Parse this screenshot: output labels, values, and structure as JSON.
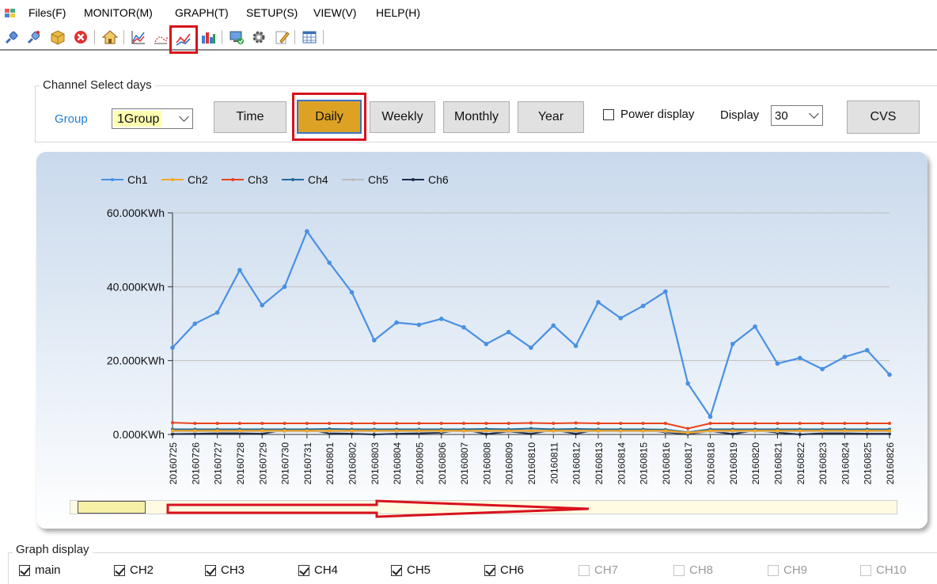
{
  "menu": [
    "Files(F)",
    "MONITOR(M)",
    "GRAPH(T)",
    "SETUP(S)",
    "VIEW(V)",
    "HELP(H)"
  ],
  "toolbar": {
    "icons": [
      "connect-icon",
      "disconnect-icon",
      "package-icon",
      "stop-icon",
      "home-icon",
      "area-chart-icon",
      "scatter-chart-icon",
      "line-chart-icon",
      "bar-chart-icon",
      "monitor-icon",
      "gear-icon",
      "edit-icon",
      "table-icon"
    ],
    "highlighted": "line-chart-icon"
  },
  "channel_select": {
    "title": "Channel Select days",
    "group_label": "Group",
    "group_value": "1Group",
    "buttons": [
      "Time",
      "Daily",
      "Weekly",
      "Monthly",
      "Year"
    ],
    "active_button": "Daily",
    "power_display_label": "Power display",
    "power_display_checked": false,
    "display_label": "Display",
    "display_value": "30",
    "cvs_label": "CVS"
  },
  "colors": {
    "ch1": "#4a90e2",
    "ch2": "#f5a623",
    "ch3": "#e8431c",
    "ch4": "#1f6a9a",
    "ch5": "#bdbdbd",
    "ch6": "#1c2b4a",
    "accent_active": "#dda224",
    "highlight_box": "#d8121c",
    "group_label": "#1e7fd6"
  },
  "chart_data": {
    "type": "line",
    "title": "",
    "xlabel": "",
    "ylabel": "",
    "y_unit": "KWh",
    "ylim": [
      0,
      60
    ],
    "y_ticks": [
      "0.000KWh",
      "20.000KWh",
      "40.000KWh",
      "60.000KWh"
    ],
    "y_tick_values": [
      0,
      20,
      40,
      60
    ],
    "grid": true,
    "legend_position": "top-left",
    "x": [
      "20160725",
      "20160726",
      "20160727",
      "20160728",
      "20160729",
      "20160730",
      "20160731",
      "20160801",
      "20160802",
      "20160803",
      "20160804",
      "20160805",
      "20160806",
      "20160807",
      "20160808",
      "20160809",
      "20160810",
      "20160811",
      "20160812",
      "20160813",
      "20160814",
      "20160815",
      "20160816",
      "20160817",
      "20160818",
      "20160819",
      "20160820",
      "20160821",
      "20160822",
      "20160823",
      "20160824",
      "20160825",
      "20160826"
    ],
    "series": [
      {
        "name": "Ch1",
        "values": [
          23.5,
          30,
          33,
          44.5,
          35,
          40,
          55,
          46.5,
          38.5,
          25.5,
          30.3,
          29.7,
          31.3,
          29,
          24.5,
          27.7,
          23.5,
          29.5,
          24,
          35.8,
          31.5,
          34.8,
          38.7,
          13.8,
          4.8,
          24.5,
          29.2,
          19.2,
          20.7,
          17.7,
          21,
          22.8,
          16.2
        ]
      },
      {
        "name": "Ch2",
        "values": [
          1,
          1,
          1,
          1,
          1,
          1,
          1,
          1,
          1,
          1,
          1,
          1,
          1,
          1,
          1,
          1,
          1,
          1,
          1,
          1,
          1,
          1,
          1,
          0.5,
          1,
          1,
          1,
          1,
          1,
          1,
          1,
          1,
          1
        ]
      },
      {
        "name": "Ch3",
        "values": [
          3.2,
          3,
          3,
          3,
          3,
          3,
          3,
          3,
          3,
          3,
          3,
          3,
          3,
          3,
          3,
          3,
          3.1,
          3,
          3.1,
          3,
          3,
          3,
          3,
          1.6,
          3,
          3,
          3,
          3,
          3,
          3,
          3,
          3,
          3
        ]
      },
      {
        "name": "Ch4",
        "values": [
          1.4,
          1.4,
          1.4,
          1.4,
          1.4,
          1.4,
          1.4,
          1.5,
          1.4,
          1.4,
          1.4,
          1.4,
          1.4,
          1.4,
          1.5,
          1.4,
          1.6,
          1.4,
          1.5,
          1.4,
          1.4,
          1.4,
          1.3,
          0.6,
          1.4,
          1.4,
          1.4,
          1.4,
          1.4,
          1.4,
          1.4,
          1.4,
          1.4
        ]
      },
      {
        "name": "Ch5",
        "values": [
          0.8,
          0.8,
          0.8,
          0.8,
          0.8,
          0.8,
          0.8,
          0.8,
          0.8,
          0.8,
          0.8,
          0.8,
          0.8,
          0.8,
          0.8,
          0.8,
          0.8,
          0.8,
          0.8,
          0.8,
          0.8,
          0.8,
          0.8,
          0.4,
          0.8,
          0.8,
          0.8,
          0.8,
          0.8,
          0.8,
          0.8,
          0.8,
          0.8
        ]
      },
      {
        "name": "Ch6",
        "values": [
          0.1,
          0.2,
          0.3,
          0.3,
          0.2,
          1.2,
          1.4,
          0.3,
          0.2,
          0,
          0.2,
          0.3,
          0.5,
          1.3,
          0.1,
          0.8,
          0.2,
          1.2,
          0.2,
          1.3,
          1.4,
          1.2,
          0.6,
          0.1,
          0.9,
          0.1,
          1.1,
          0.5,
          0,
          0.3,
          0.3,
          0.2,
          0.2
        ]
      }
    ]
  },
  "graph_display": {
    "title": "Graph display",
    "items": [
      {
        "label": "main",
        "checked": true,
        "enabled": true
      },
      {
        "label": "CH2",
        "checked": true,
        "enabled": true
      },
      {
        "label": "CH3",
        "checked": true,
        "enabled": true
      },
      {
        "label": "CH4",
        "checked": true,
        "enabled": true
      },
      {
        "label": "CH5",
        "checked": true,
        "enabled": true
      },
      {
        "label": "CH6",
        "checked": true,
        "enabled": true
      },
      {
        "label": "CH7",
        "checked": false,
        "enabled": false
      },
      {
        "label": "CH8",
        "checked": false,
        "enabled": false
      },
      {
        "label": "CH9",
        "checked": false,
        "enabled": false
      },
      {
        "label": "CH10",
        "checked": false,
        "enabled": false
      }
    ]
  }
}
